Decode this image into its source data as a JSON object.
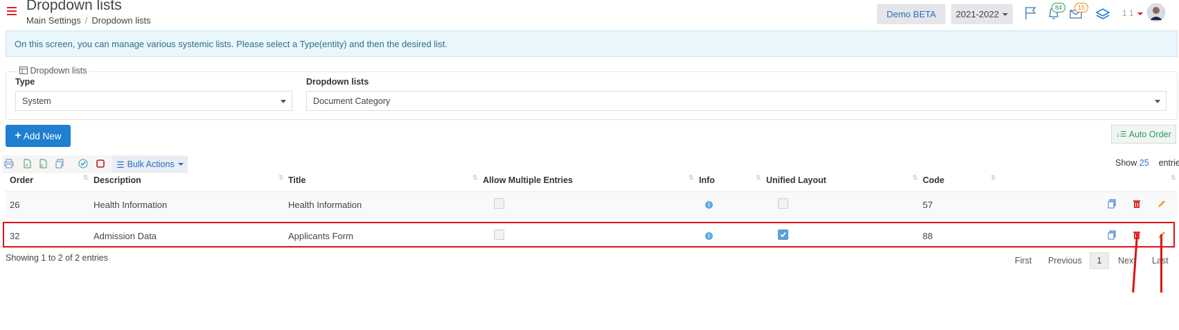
{
  "header": {
    "title": "Dropdown lists",
    "breadcrumb": [
      "Main Settings",
      "Dropdown lists"
    ],
    "breadcrumb_sep": "/",
    "demo_label": "Demo BETA",
    "year": "2021-2022",
    "notifications_count": "84",
    "messages_count": "15",
    "user_count": "1 1"
  },
  "info_text": "On this screen, you can manage various systemic lists. Please select a Type(entity) and then the desired list.",
  "filter": {
    "legend": "Dropdown lists",
    "type_label": "Type",
    "type_value": "System",
    "list_label": "Dropdown lists",
    "list_value": "Document Category"
  },
  "buttons": {
    "add_new": "Add New",
    "auto_order": "Auto Order",
    "bulk_actions": "Bulk Actions"
  },
  "show": {
    "label": "Show",
    "value": "25",
    "suffix": "entries"
  },
  "table": {
    "columns": [
      "Order",
      "Description",
      "Title",
      "Allow Multiple Entries",
      "Info",
      "Unified Layout",
      "Code"
    ],
    "rows": [
      {
        "order": "26",
        "description": "Health Information",
        "title": "Health Information",
        "allow_multiple": false,
        "unified_layout": false,
        "code": "57"
      },
      {
        "order": "32",
        "description": "Admission Data",
        "title": "Applicants Form",
        "allow_multiple": false,
        "unified_layout": true,
        "code": "88"
      }
    ]
  },
  "footer": {
    "showing": "Showing 1 to 2 of 2 entries",
    "pagination": {
      "first": "First",
      "previous": "Previous",
      "current": "1",
      "next": "Next",
      "last": "Last"
    }
  },
  "colors": {
    "accent": "#1f7fd1",
    "danger": "#e01010",
    "edit": "#f0a030"
  },
  "icons": [
    "hamburger-icon",
    "flag-icon",
    "bell-icon",
    "mail-icon",
    "layers-icon",
    "print-icon",
    "excel-icon",
    "pdf-icon",
    "copy-icon",
    "check-all-icon",
    "uncheck-icon",
    "list-icon",
    "copy-row-icon",
    "trash-icon",
    "pencil-icon",
    "info-icon",
    "sort-icon"
  ]
}
